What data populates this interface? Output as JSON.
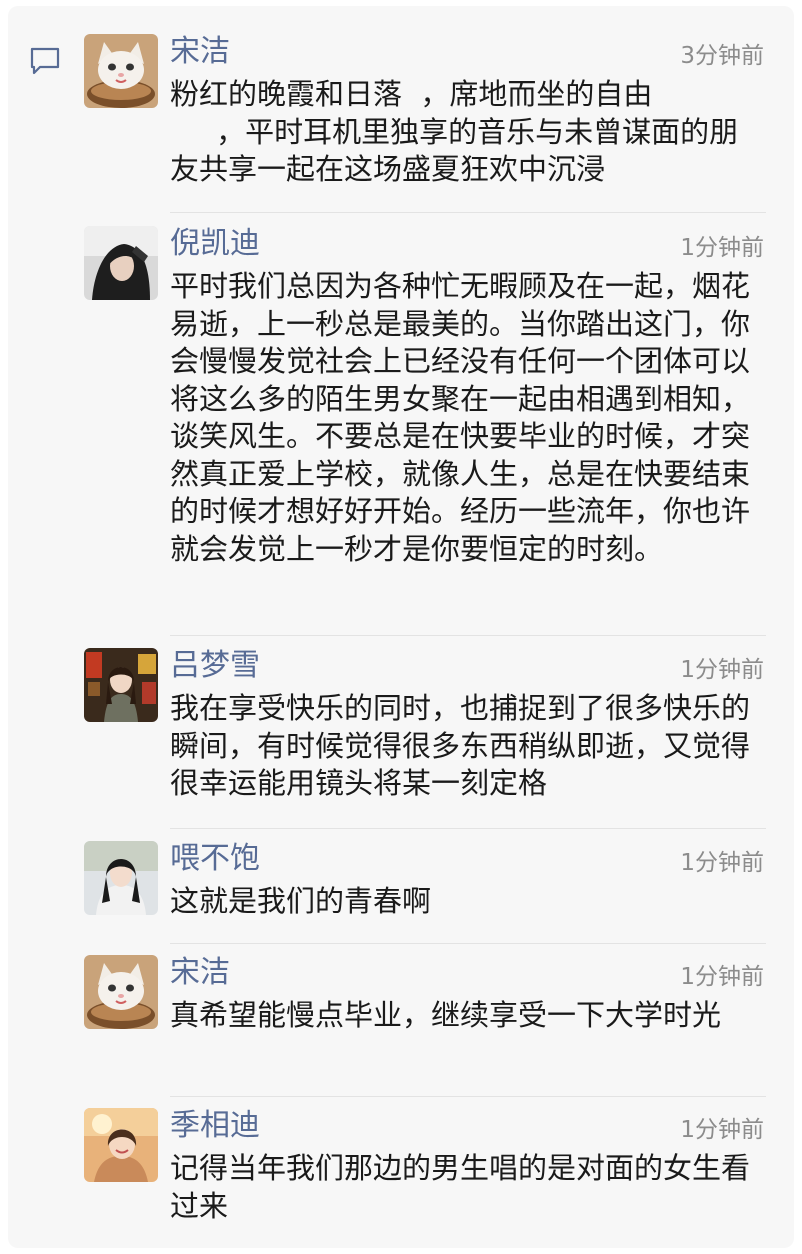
{
  "comments": [
    {
      "name": "宋洁",
      "time": "3分钟前",
      "text": "粉红的晚霞和日落  ，席地而坐的自由\n     ，平时耳机里独享的音乐与未曾谋面的朋友共享一起在这场盛夏狂欢中沉浸"
    },
    {
      "name": "倪凯迪",
      "time": "1分钟前",
      "text": "平时我们总因为各种忙无暇顾及在一起，烟花易逝，上一秒总是最美的。当你踏出这门，你会慢慢发觉社会上已经没有任何一个团体可以将这么多的陌生男女聚在一起由相遇到相知，谈笑风生。不要总是在快要毕业的时候，才突然真正爱上学校，就像人生，总是在快要结束的时候才想好好开始。经历一些流年，你也许就会发觉上一秒才是你要恒定的时刻。"
    },
    {
      "name": "吕梦雪",
      "time": "1分钟前",
      "text": "我在享受快乐的同时，也捕捉到了很多快乐的瞬间，有时候觉得很多东西稍纵即逝，又觉得很幸运能用镜头将某一刻定格"
    },
    {
      "name": "喂不饱",
      "time": "1分钟前",
      "text": "这就是我们的青春啊"
    },
    {
      "name": "宋洁",
      "time": "1分钟前",
      "text": "真希望能慢点毕业，继续享受一下大学时光"
    },
    {
      "name": "季相迪",
      "time": "1分钟前",
      "text": "记得当年我们那边的男生唱的是对面的女生看过来"
    }
  ],
  "icons": {
    "comment": "comment-bubble-icon"
  },
  "colors": {
    "name": "#576b95",
    "time": "#8c8c8c",
    "text": "#1a1a1a",
    "background": "#f7f7f7",
    "divider": "#e3e3e3"
  }
}
